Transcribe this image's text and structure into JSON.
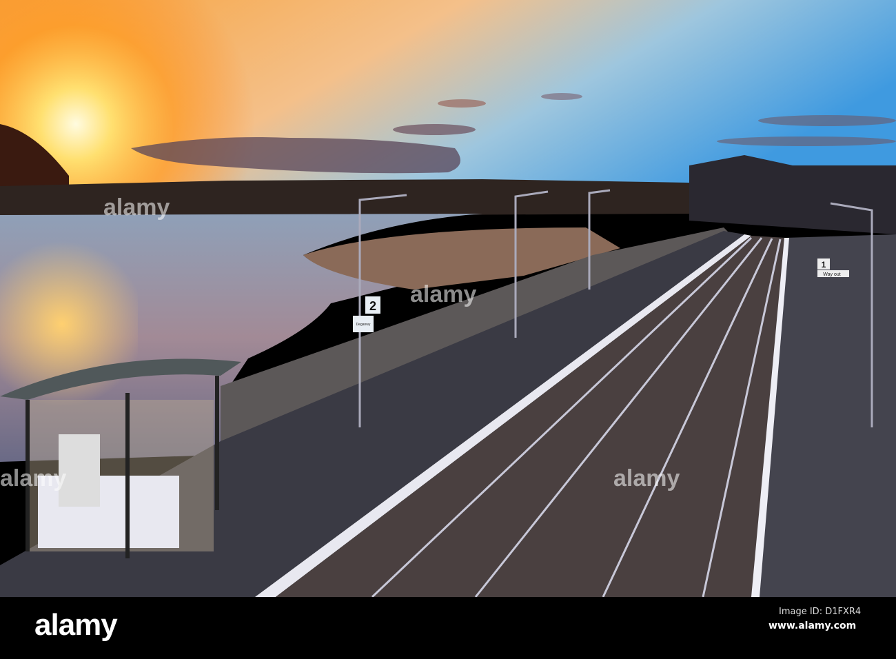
{
  "photo": {
    "subject": "Deganwy railway station at sunset",
    "platform_sign_number": "2",
    "station_sign": "Deganwy",
    "far_platform_number": "1",
    "way_out_sign": "Way out"
  },
  "watermark": {
    "logo": "alamy"
  },
  "footer": {
    "logo": "alamy",
    "image_id": "Image ID: D1FXR4",
    "url": "www.alamy.com"
  },
  "colors": {
    "sky_top": "#4fa3e0",
    "sky_sun": "#ffb330",
    "water": "#7a6a8a",
    "rail": "#d8d8e8"
  }
}
